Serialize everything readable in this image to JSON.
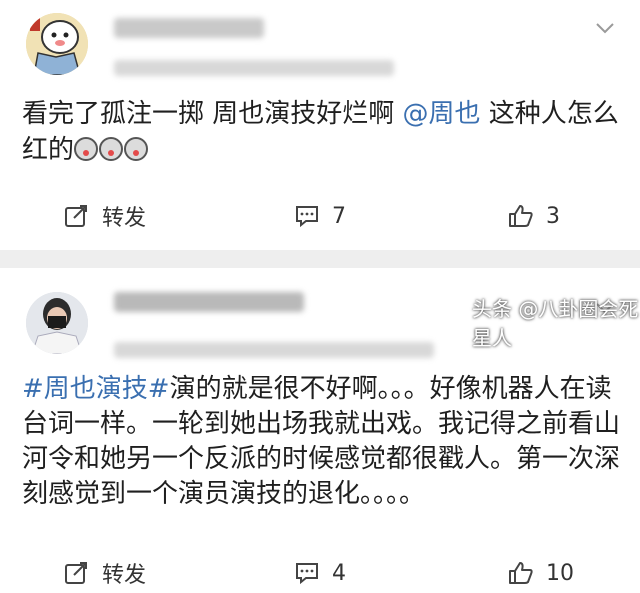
{
  "posts": [
    {
      "content_text": "看完了孤注一掷 周也演技好烂啊 ",
      "mention": "@周也",
      "content_after": " 这种人怎么红的",
      "emoji_count": 3,
      "actions": {
        "repost_label": "转发",
        "comment_count": "7",
        "like_count": "3"
      }
    },
    {
      "hashtag": "#周也演技#",
      "content_text": "演的就是很不好啊。。。好像机器人在读台词一样。一轮到她出场我就出戏。我记得之前看山河令和她另一个反派的时候感觉都很戳人。第一次深刻感觉到一个演员演技的退化。。。。",
      "actions": {
        "repost_label": "转发",
        "comment_count": "4",
        "like_count": "10"
      }
    }
  ],
  "watermark": "头条 @八卦圈会死星人",
  "colors": {
    "link": "#3a6fb0",
    "separator": "#eeeeee",
    "icon": "#444444"
  }
}
